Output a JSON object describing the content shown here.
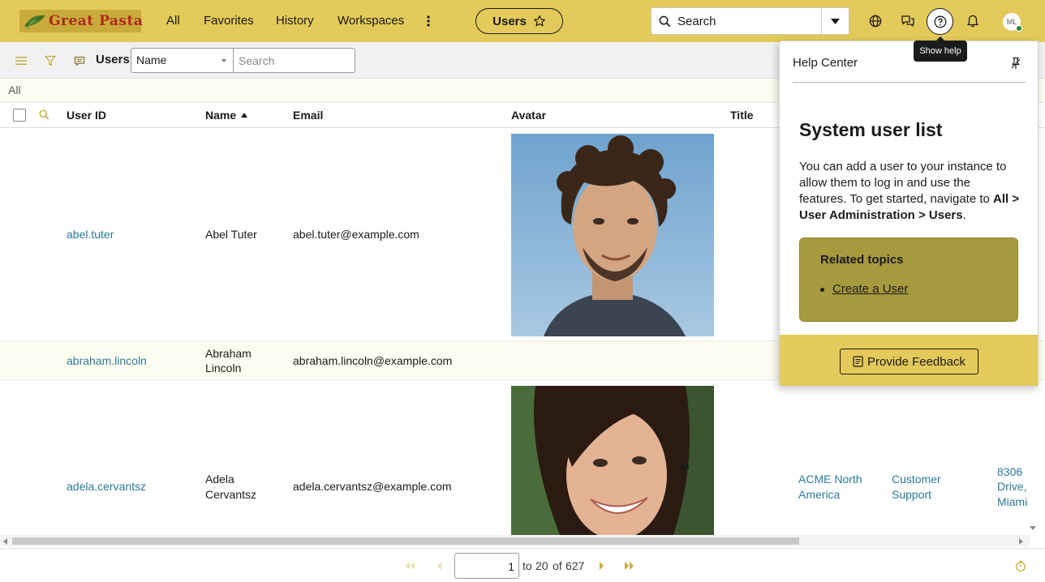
{
  "header": {
    "brand": "Great Pasta",
    "nav": [
      "All",
      "Favorites",
      "History",
      "Workspaces"
    ],
    "context_pill": "Users",
    "search_label": "Search",
    "user_initials": "ML",
    "tooltip": "Show help",
    "accent_color": "#e3ca5a"
  },
  "list": {
    "title": "Users",
    "field_select": "Name",
    "search_placeholder": "Search",
    "breadcrumb": "All"
  },
  "table": {
    "columns": [
      "User ID",
      "Name",
      "Email",
      "Avatar",
      "Title"
    ],
    "sorted_column": "Name",
    "sort_direction": "ascending",
    "rows": [
      {
        "user_id": "abel.tuter",
        "name": "Abel Tuter",
        "email": "abel.tuter@example.com",
        "has_avatar": true
      },
      {
        "user_id": "abraham.lincoln",
        "name_line1": "Abraham",
        "name_line2": "Lincoln",
        "email": "abraham.lincoln@example.com",
        "has_avatar": false
      },
      {
        "user_id": "adela.cervantsz",
        "name_line1": "Adela",
        "name_line2": "Cervantsz",
        "email": "adela.cervantsz@example.com",
        "has_avatar": true,
        "company_line1": "ACME North",
        "company_line2": "America",
        "department_line1": "Customer",
        "department_line2": "Support",
        "location_line1": "8306",
        "location_line2": "Drive,",
        "location_line3": "Miami"
      }
    ]
  },
  "pagination": {
    "current": "1",
    "to_label": "to",
    "range_end": "20",
    "of_label": "of",
    "total": "627"
  },
  "help_panel": {
    "header": "Help Center",
    "title": "System user list",
    "body_text": "You can add a user to your instance to allow them to log in and use the features. To get started, navigate to ",
    "body_bold": "All > User Administration > Users",
    "body_end": ".",
    "related_title": "Related topics",
    "related_links": [
      "Create a User"
    ],
    "feedback_button": "Provide Feedback"
  }
}
